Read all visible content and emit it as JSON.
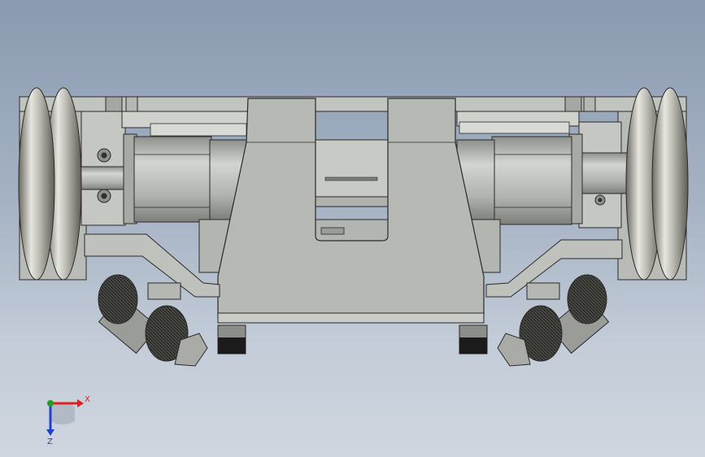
{
  "colors": {
    "metal_light": "#c9cbc6",
    "metal_mid": "#a9aba6",
    "metal_dark": "#7f817d",
    "edge": "#2a2a2a",
    "wheel_light": "#e2e2dc",
    "wheel_dark": "#6b6a62",
    "motor_dark": "#3a3a36",
    "pad_dark": "#1b1b1b",
    "axis_x": "#e02020",
    "axis_y": "#20a020",
    "axis_z": "#2040d0"
  },
  "triad": {
    "x_label": "X",
    "z_label": "Z"
  }
}
